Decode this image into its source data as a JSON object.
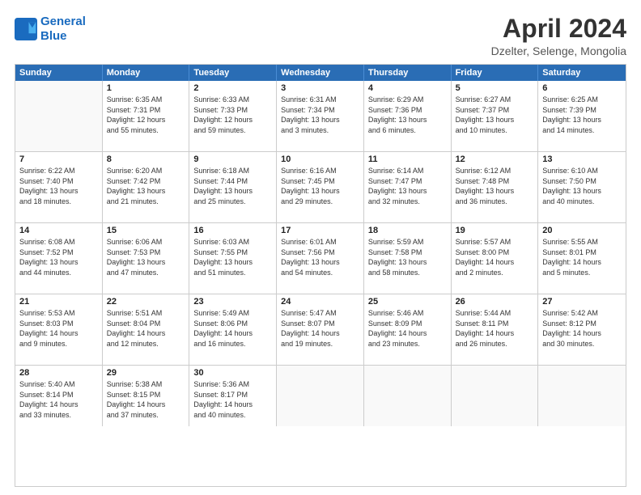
{
  "header": {
    "logo_line1": "General",
    "logo_line2": "Blue",
    "title": "April 2024",
    "subtitle": "Dzelter, Selenge, Mongolia"
  },
  "days_of_week": [
    "Sunday",
    "Monday",
    "Tuesday",
    "Wednesday",
    "Thursday",
    "Friday",
    "Saturday"
  ],
  "weeks": [
    [
      {
        "day": "",
        "lines": []
      },
      {
        "day": "1",
        "lines": [
          "Sunrise: 6:35 AM",
          "Sunset: 7:31 PM",
          "Daylight: 12 hours",
          "and 55 minutes."
        ]
      },
      {
        "day": "2",
        "lines": [
          "Sunrise: 6:33 AM",
          "Sunset: 7:33 PM",
          "Daylight: 12 hours",
          "and 59 minutes."
        ]
      },
      {
        "day": "3",
        "lines": [
          "Sunrise: 6:31 AM",
          "Sunset: 7:34 PM",
          "Daylight: 13 hours",
          "and 3 minutes."
        ]
      },
      {
        "day": "4",
        "lines": [
          "Sunrise: 6:29 AM",
          "Sunset: 7:36 PM",
          "Daylight: 13 hours",
          "and 6 minutes."
        ]
      },
      {
        "day": "5",
        "lines": [
          "Sunrise: 6:27 AM",
          "Sunset: 7:37 PM",
          "Daylight: 13 hours",
          "and 10 minutes."
        ]
      },
      {
        "day": "6",
        "lines": [
          "Sunrise: 6:25 AM",
          "Sunset: 7:39 PM",
          "Daylight: 13 hours",
          "and 14 minutes."
        ]
      }
    ],
    [
      {
        "day": "7",
        "lines": [
          "Sunrise: 6:22 AM",
          "Sunset: 7:40 PM",
          "Daylight: 13 hours",
          "and 18 minutes."
        ]
      },
      {
        "day": "8",
        "lines": [
          "Sunrise: 6:20 AM",
          "Sunset: 7:42 PM",
          "Daylight: 13 hours",
          "and 21 minutes."
        ]
      },
      {
        "day": "9",
        "lines": [
          "Sunrise: 6:18 AM",
          "Sunset: 7:44 PM",
          "Daylight: 13 hours",
          "and 25 minutes."
        ]
      },
      {
        "day": "10",
        "lines": [
          "Sunrise: 6:16 AM",
          "Sunset: 7:45 PM",
          "Daylight: 13 hours",
          "and 29 minutes."
        ]
      },
      {
        "day": "11",
        "lines": [
          "Sunrise: 6:14 AM",
          "Sunset: 7:47 PM",
          "Daylight: 13 hours",
          "and 32 minutes."
        ]
      },
      {
        "day": "12",
        "lines": [
          "Sunrise: 6:12 AM",
          "Sunset: 7:48 PM",
          "Daylight: 13 hours",
          "and 36 minutes."
        ]
      },
      {
        "day": "13",
        "lines": [
          "Sunrise: 6:10 AM",
          "Sunset: 7:50 PM",
          "Daylight: 13 hours",
          "and 40 minutes."
        ]
      }
    ],
    [
      {
        "day": "14",
        "lines": [
          "Sunrise: 6:08 AM",
          "Sunset: 7:52 PM",
          "Daylight: 13 hours",
          "and 44 minutes."
        ]
      },
      {
        "day": "15",
        "lines": [
          "Sunrise: 6:06 AM",
          "Sunset: 7:53 PM",
          "Daylight: 13 hours",
          "and 47 minutes."
        ]
      },
      {
        "day": "16",
        "lines": [
          "Sunrise: 6:03 AM",
          "Sunset: 7:55 PM",
          "Daylight: 13 hours",
          "and 51 minutes."
        ]
      },
      {
        "day": "17",
        "lines": [
          "Sunrise: 6:01 AM",
          "Sunset: 7:56 PM",
          "Daylight: 13 hours",
          "and 54 minutes."
        ]
      },
      {
        "day": "18",
        "lines": [
          "Sunrise: 5:59 AM",
          "Sunset: 7:58 PM",
          "Daylight: 13 hours",
          "and 58 minutes."
        ]
      },
      {
        "day": "19",
        "lines": [
          "Sunrise: 5:57 AM",
          "Sunset: 8:00 PM",
          "Daylight: 14 hours",
          "and 2 minutes."
        ]
      },
      {
        "day": "20",
        "lines": [
          "Sunrise: 5:55 AM",
          "Sunset: 8:01 PM",
          "Daylight: 14 hours",
          "and 5 minutes."
        ]
      }
    ],
    [
      {
        "day": "21",
        "lines": [
          "Sunrise: 5:53 AM",
          "Sunset: 8:03 PM",
          "Daylight: 14 hours",
          "and 9 minutes."
        ]
      },
      {
        "day": "22",
        "lines": [
          "Sunrise: 5:51 AM",
          "Sunset: 8:04 PM",
          "Daylight: 14 hours",
          "and 12 minutes."
        ]
      },
      {
        "day": "23",
        "lines": [
          "Sunrise: 5:49 AM",
          "Sunset: 8:06 PM",
          "Daylight: 14 hours",
          "and 16 minutes."
        ]
      },
      {
        "day": "24",
        "lines": [
          "Sunrise: 5:47 AM",
          "Sunset: 8:07 PM",
          "Daylight: 14 hours",
          "and 19 minutes."
        ]
      },
      {
        "day": "25",
        "lines": [
          "Sunrise: 5:46 AM",
          "Sunset: 8:09 PM",
          "Daylight: 14 hours",
          "and 23 minutes."
        ]
      },
      {
        "day": "26",
        "lines": [
          "Sunrise: 5:44 AM",
          "Sunset: 8:11 PM",
          "Daylight: 14 hours",
          "and 26 minutes."
        ]
      },
      {
        "day": "27",
        "lines": [
          "Sunrise: 5:42 AM",
          "Sunset: 8:12 PM",
          "Daylight: 14 hours",
          "and 30 minutes."
        ]
      }
    ],
    [
      {
        "day": "28",
        "lines": [
          "Sunrise: 5:40 AM",
          "Sunset: 8:14 PM",
          "Daylight: 14 hours",
          "and 33 minutes."
        ]
      },
      {
        "day": "29",
        "lines": [
          "Sunrise: 5:38 AM",
          "Sunset: 8:15 PM",
          "Daylight: 14 hours",
          "and 37 minutes."
        ]
      },
      {
        "day": "30",
        "lines": [
          "Sunrise: 5:36 AM",
          "Sunset: 8:17 PM",
          "Daylight: 14 hours",
          "and 40 minutes."
        ]
      },
      {
        "day": "",
        "lines": []
      },
      {
        "day": "",
        "lines": []
      },
      {
        "day": "",
        "lines": []
      },
      {
        "day": "",
        "lines": []
      }
    ]
  ]
}
